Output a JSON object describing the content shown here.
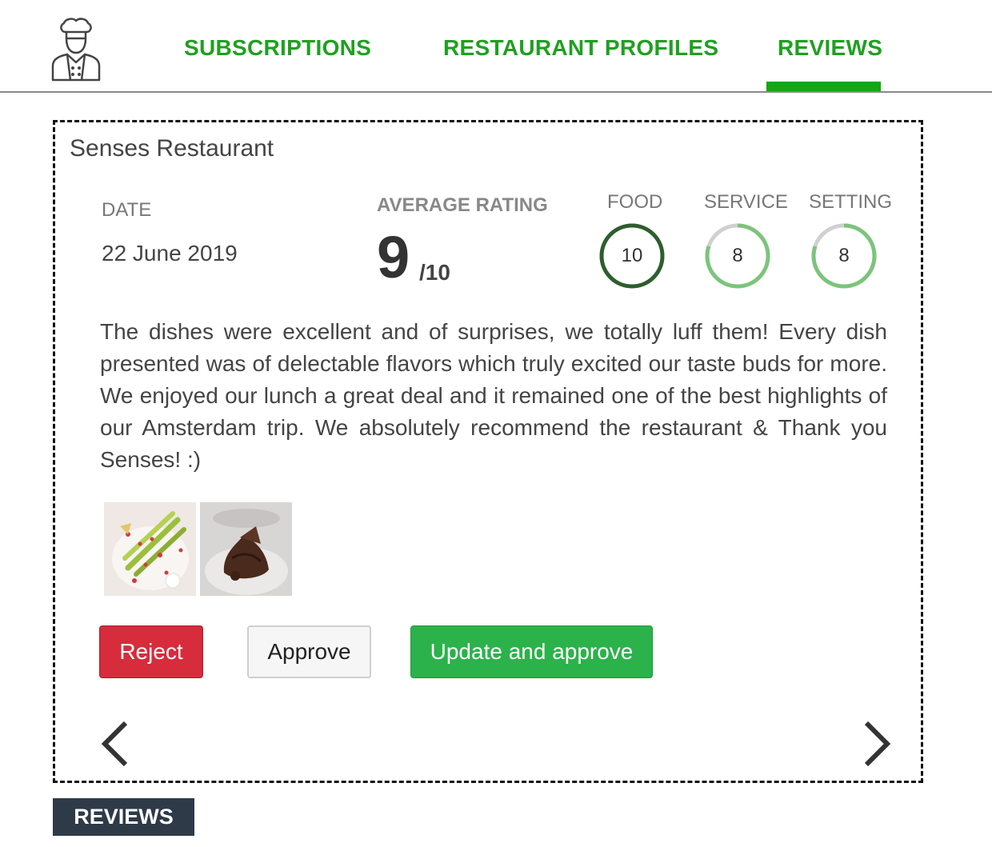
{
  "nav": {
    "tabs": [
      {
        "label": "SUBSCRIPTIONS"
      },
      {
        "label": "RESTAURANT PROFILES"
      },
      {
        "label": "REVIEWS",
        "active": true
      }
    ],
    "accent_color": "#16a516"
  },
  "review": {
    "restaurant_name": "Senses Restaurant",
    "date_label": "DATE",
    "date_value": "22 June 2019",
    "average_rating_label": "AVERAGE RATING",
    "average_rating_value": "9",
    "average_rating_denominator": "/10",
    "scores": [
      {
        "label": "FOOD",
        "value": "10",
        "fraction": 1.0,
        "color": "#2e5e2e"
      },
      {
        "label": "SERVICE",
        "value": "8",
        "fraction": 0.8,
        "color": "#7cc47c"
      },
      {
        "label": "SETTING",
        "value": "8",
        "fraction": 0.8,
        "color": "#7cc47c"
      }
    ],
    "text": "The dishes were excellent and of surprises, we totally luff them! Every dish presented was of delectable flavors which truly excited our taste buds for more. We enjoyed our lunch a great deal and it remained one of the best highlights of our Amsterdam trip. We absolutely recommend the restaurant & Thank you Senses! :)",
    "photos": [
      "asparagus-dish-photo",
      "chocolate-dessert-photo"
    ]
  },
  "actions": {
    "reject_label": "Reject",
    "approve_label": "Approve",
    "update_label": "Update and approve",
    "reject_color": "#d62c3c",
    "update_color": "#2bb24a"
  },
  "navigation_icons": [
    "chevron-left-icon",
    "chevron-right-icon"
  ],
  "caption": "REVIEWS"
}
